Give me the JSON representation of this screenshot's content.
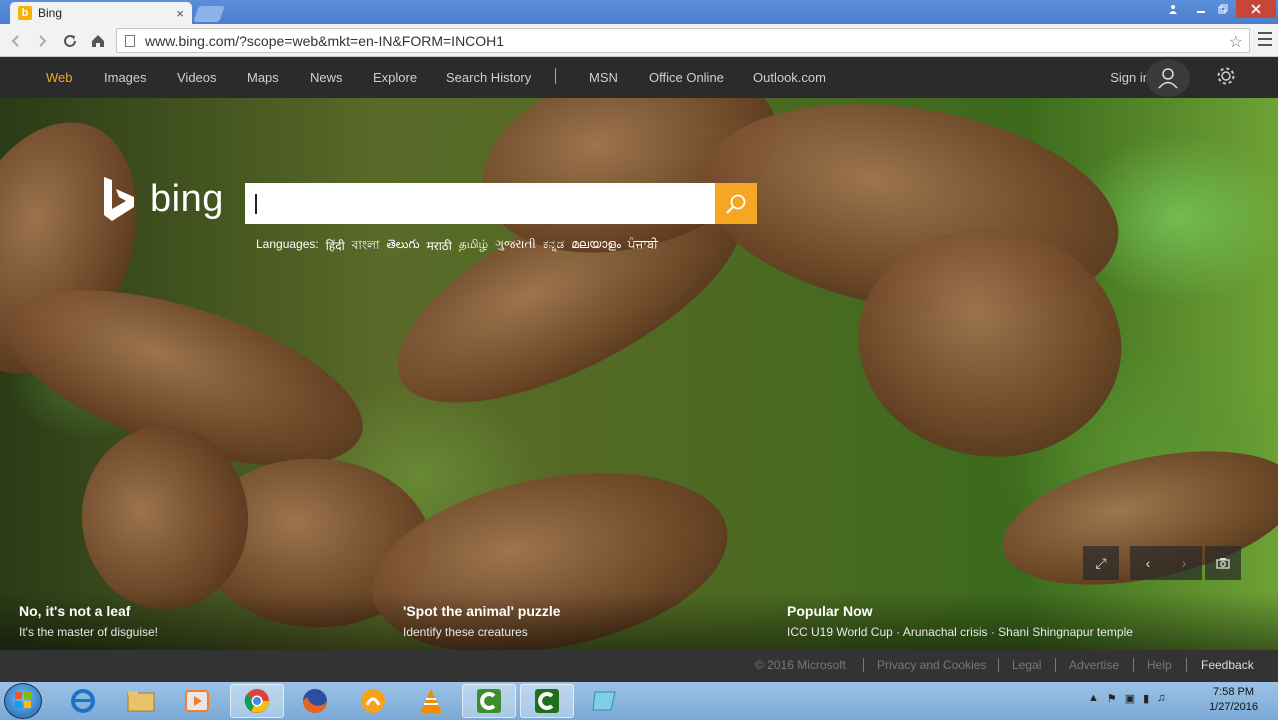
{
  "browser": {
    "tab_title": "Bing",
    "tab_close": "×",
    "url": "www.bing.com/?scope=web&mkt=en-IN&FORM=INCOH1"
  },
  "nav": {
    "items": [
      "Web",
      "Images",
      "Videos",
      "Maps",
      "News",
      "Explore",
      "Search History",
      "MSN",
      "Office Online",
      "Outlook.com"
    ],
    "sign_in": "Sign in"
  },
  "logo": {
    "text": "bing"
  },
  "search": {
    "placeholder": ""
  },
  "languages": {
    "label": "Languages:",
    "items": [
      "हिंदी",
      "বাংলা",
      "తెలుగు",
      "मराठी",
      "தமிழ்",
      "ગુજરાતી",
      "ಕನ್ನಡ",
      "മലയാളം",
      "ਪੰਜਾਬੀ"
    ]
  },
  "captions": [
    {
      "title": "No, it's not a leaf",
      "subtitle": "It's the master of disguise!"
    },
    {
      "title": "'Spot the animal' puzzle",
      "subtitle": "Identify these creatures"
    },
    {
      "title": "Popular Now",
      "subtitle": "ICC U19 World Cup · Arunachal crisis · Shani Shingnapur temple"
    }
  ],
  "footer": {
    "copyright": "© 2016 Microsoft",
    "links": [
      "Privacy and Cookies",
      "Legal",
      "Advertise",
      "Help",
      "Feedback"
    ]
  },
  "clock": {
    "time": "7:58 PM",
    "date": "1/27/2016"
  },
  "colors": {
    "accent": "#f5a623",
    "nav_bg": "#2b2b2b",
    "footer_bg": "#333333"
  }
}
